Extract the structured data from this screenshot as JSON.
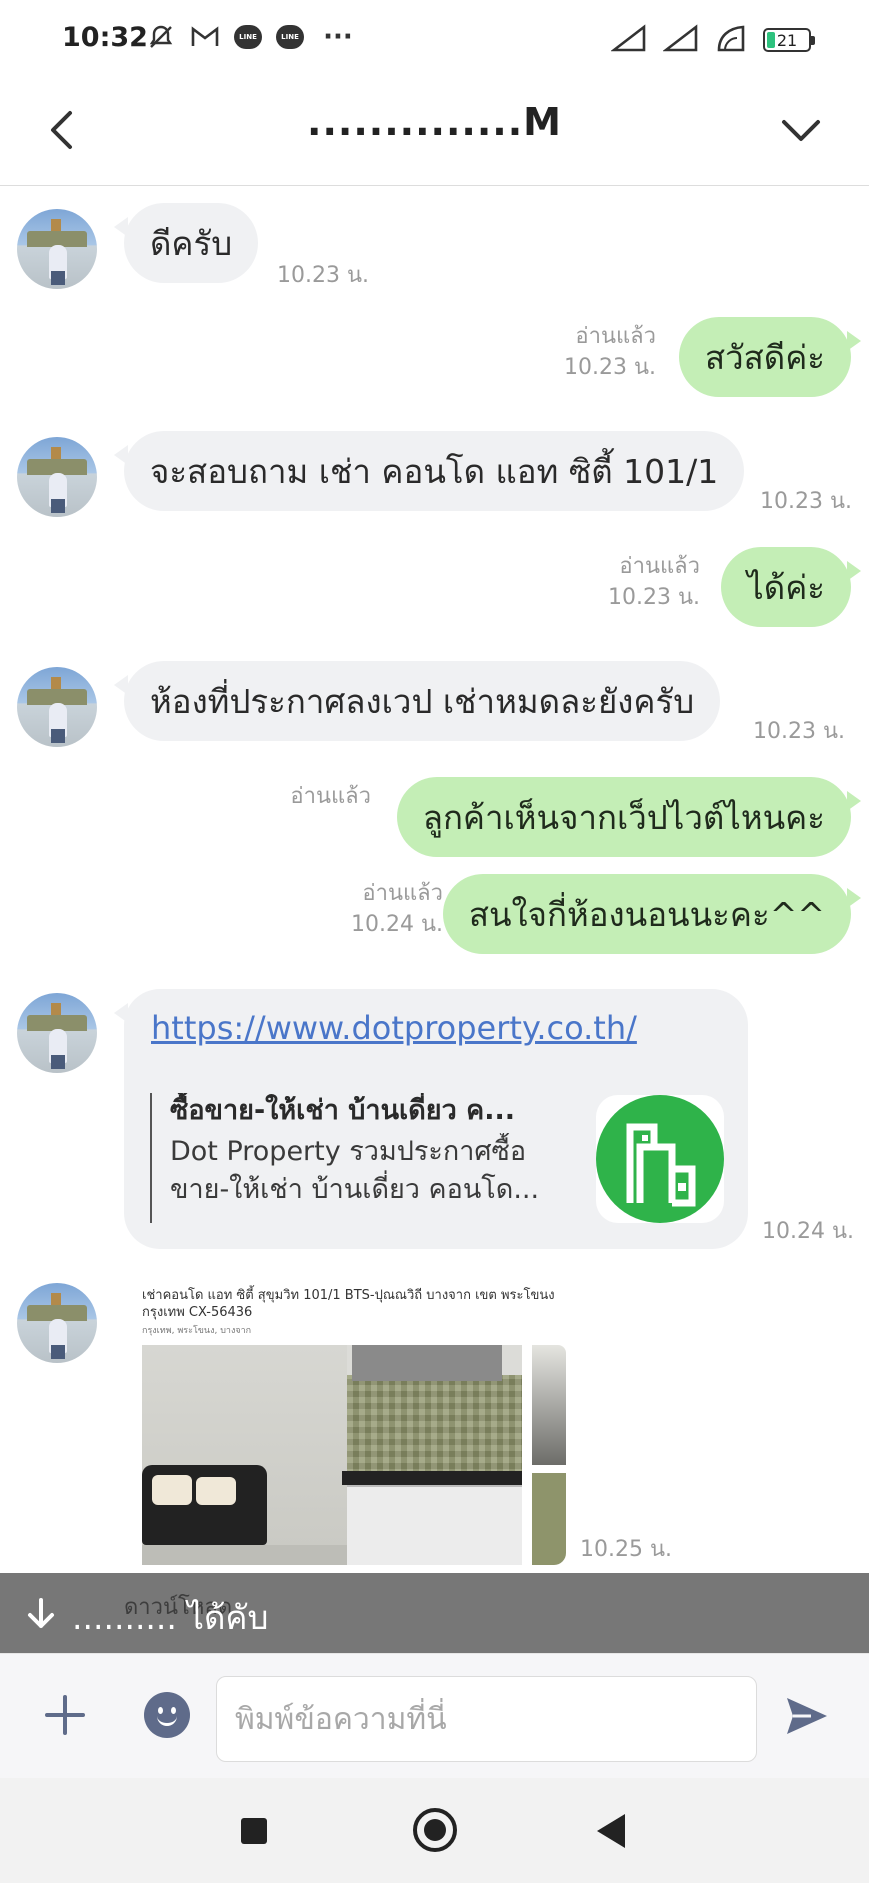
{
  "status_bar": {
    "time": "10:32",
    "icons_left": [
      "mute-icon",
      "gmail-icon",
      "line-icon",
      "line-icon",
      "more-dots"
    ],
    "line_label": "LINE",
    "more": "···",
    "battery": "21",
    "icons_right": [
      "signal-icon",
      "signal-icon",
      "wifi-icon",
      "battery-icon"
    ]
  },
  "header": {
    "title": "..............M",
    "back_icon": "chevron-left-icon",
    "menu_icon": "chevron-down-icon"
  },
  "messages": [
    {
      "side": "in",
      "text": "ดีครับ",
      "time": "10.23 น."
    },
    {
      "side": "out",
      "text": "สวัสดีค่ะ",
      "read": "อ่านแล้ว",
      "time": "10.23 น."
    },
    {
      "side": "in",
      "text": "จะสอบถาม เช่า คอนโด แอท ซิตี้ 101/1",
      "time": "10.23 น."
    },
    {
      "side": "out",
      "text": "ได้ค่ะ",
      "read": "อ่านแล้ว",
      "time": "10.23 น."
    },
    {
      "side": "in",
      "text": "ห้องที่ประกาศลงเวป เช่าหมดละยังครับ",
      "time": "10.23 น."
    },
    {
      "side": "out",
      "text": "ลูกค้าเห็นจากเว็ปไวต์ไหนคะ",
      "read": "อ่านแล้ว",
      "time": ""
    },
    {
      "side": "out",
      "text": "สนใจกี่ห้องนอนนะคะ^^",
      "read": "อ่านแล้ว",
      "time": "10.24 น."
    }
  ],
  "link_message": {
    "url": "https://www.dotproperty.co.th/",
    "title": "ซื้อขาย-ให้เช่า บ้านเดี่ยว ค...",
    "description": "Dot Property รวมประกาศซื้อขาย-ให้เช่า บ้านเดี่ยว คอนโด...",
    "time": "10.24 น.",
    "thumb_color": "#2fb34a"
  },
  "image_message": {
    "caption": "เช่าคอนโด แอท ซิตี้ สุขุมวิท 101/1 BTS-ปุณณวิถี บางจาก เขต พระโขนง กรุงเทพ CX-56436",
    "sub": "กรุงเทพ, พระโขนง, บางจาก",
    "time": "10.25 น."
  },
  "notice_bar": {
    "text": ".......... ได้คับ",
    "ghost": "ดาวน์โหลด"
  },
  "input_bar": {
    "placeholder": "พิมพ์ข้อความที่นี่"
  },
  "colors": {
    "bubble_in": "#f0f1f3",
    "bubble_out": "#c4eeb6",
    "link": "#4a76c9",
    "send_icon": "#5f6b8a"
  }
}
